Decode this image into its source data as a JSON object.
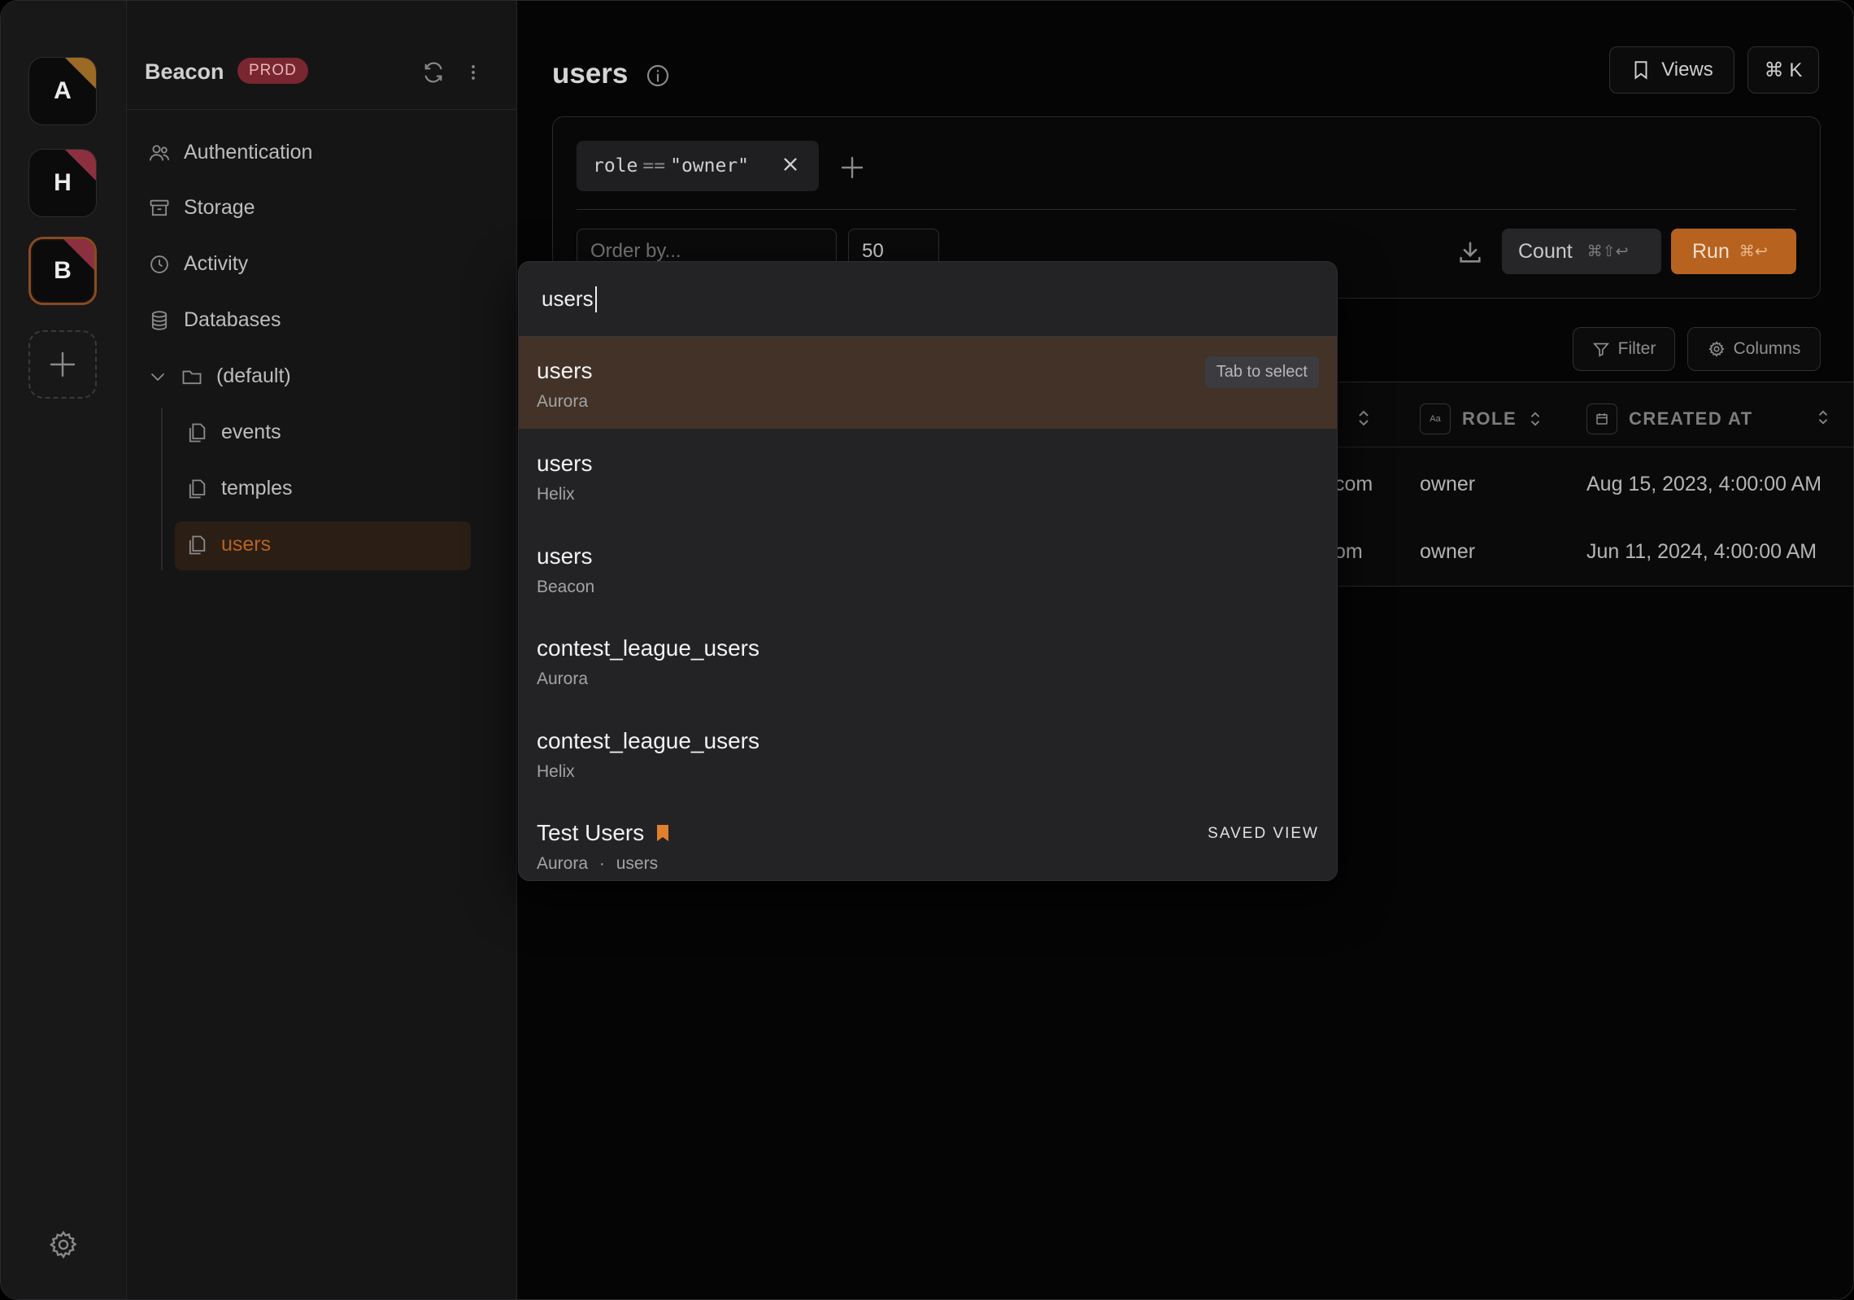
{
  "window": {
    "traffic_colors": [
      "#fe5f57",
      "#febc2e",
      "#28c840"
    ]
  },
  "workspaces": [
    {
      "letter": "A",
      "accent": "#9b6a24"
    },
    {
      "letter": "H",
      "accent": "#8c3040"
    },
    {
      "letter": "B",
      "accent": "#8c3040",
      "active": true
    }
  ],
  "sidebar": {
    "title": "Beacon",
    "env_badge": "PROD",
    "items": {
      "authentication": "Authentication",
      "storage": "Storage",
      "activity": "Activity",
      "databases": "Databases",
      "default_folder": "(default)",
      "events": "events",
      "temples": "temples",
      "users": "users"
    }
  },
  "main": {
    "title": "users",
    "views_label": "Views",
    "shortcut_label": "⌘ K",
    "filter_chip": {
      "field": "role",
      "op": "==",
      "value": "\"owner\""
    },
    "order_placeholder": "Order by...",
    "limit_value": "50",
    "count_label": "Count",
    "count_kbd": "⌘⇧↩",
    "run_label": "Run",
    "run_kbd": "⌘↩",
    "filter_btn": "Filter",
    "columns_btn": "Columns"
  },
  "table": {
    "headers": {
      "role": "ROLE",
      "created_at": "CREATED AT",
      "role_icon": "Aa"
    },
    "rows": [
      {
        "email_tail": "com",
        "role": "owner",
        "created_at": "Aug 15, 2023, 4:00:00 AM"
      },
      {
        "email_tail": "om",
        "role": "owner",
        "created_at": "Jun 11, 2024, 4:00:00 AM"
      }
    ]
  },
  "palette": {
    "query": "users",
    "select_hint": "Tab to select",
    "saved_tag": "SAVED VIEW",
    "results": [
      {
        "name": "users",
        "source": "Aurora"
      },
      {
        "name": "users",
        "source": "Helix"
      },
      {
        "name": "users",
        "source": "Beacon"
      },
      {
        "name": "contest_league_users",
        "source": "Aurora"
      },
      {
        "name": "contest_league_users",
        "source": "Helix"
      },
      {
        "name": "Test Users",
        "source": "Aurora",
        "separator": "·",
        "collection": "users"
      }
    ]
  },
  "colors": {
    "accent": "#b8621f",
    "selected_bg": "#433228",
    "prod_badge": "#7a2630"
  }
}
